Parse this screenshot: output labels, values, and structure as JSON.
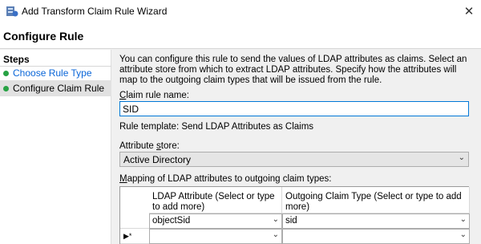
{
  "window": {
    "title": "Add Transform Claim Rule Wizard",
    "close_glyph": "✕"
  },
  "header": {
    "title": "Configure Rule"
  },
  "sidebar": {
    "heading": "Steps",
    "items": [
      {
        "label": "Choose Rule Type",
        "status": "complete",
        "link": true
      },
      {
        "label": "Configure Claim Rule",
        "status": "complete",
        "selected": true
      }
    ]
  },
  "main": {
    "description": "You can configure this rule to send the values of LDAP attributes as claims. Select an attribute store from which to extract LDAP attributes. Specify how the attributes will map to the outgoing claim types that will be issued from the rule.",
    "rule_name_label_first": "C",
    "rule_name_label_rest": "laim rule name:",
    "rule_name_value": "SID",
    "template_text": "Rule template: Send LDAP Attributes as Claims",
    "store_label_pre": "Attribute ",
    "store_label_u": "s",
    "store_label_post": "tore:",
    "store_value": "Active Directory",
    "mapping_label_first": "M",
    "mapping_label_rest": "apping of LDAP attributes to outgoing claim types:",
    "grid": {
      "col1_header": "LDAP Attribute (Select or type to add more)",
      "col2_header": "Outgoing Claim Type (Select or type to add more)",
      "rows": [
        {
          "marker": "",
          "ldap": "objectSid",
          "claim": "sid"
        },
        {
          "marker": "▶*",
          "ldap": "",
          "claim": ""
        }
      ]
    }
  },
  "colors": {
    "link": "#0a66d8",
    "step_dot": "#27a244",
    "focus_border": "#0078d7"
  }
}
